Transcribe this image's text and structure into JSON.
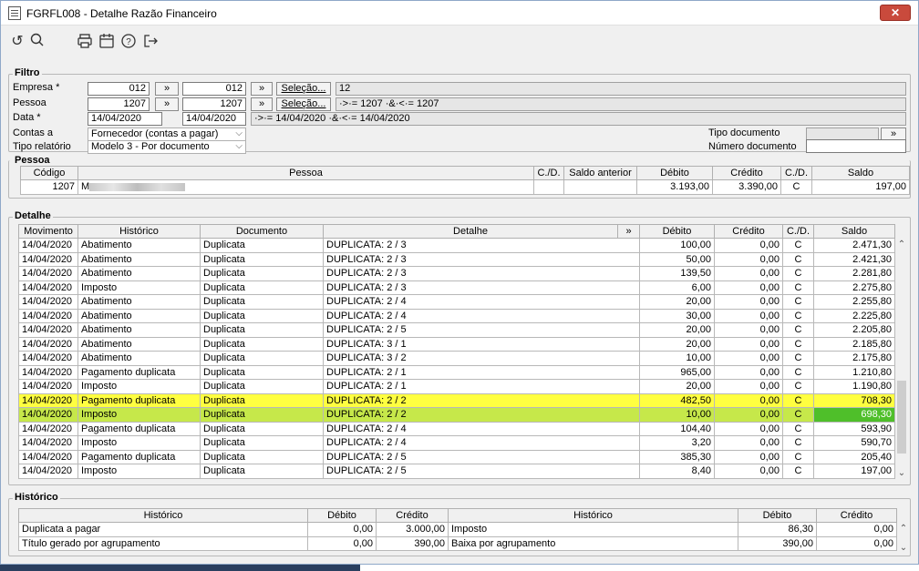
{
  "window": {
    "title": "FGRFL008 - Detalhe Razão Financeiro",
    "close": "✕"
  },
  "toolbar": {
    "undo_icon": "↺",
    "search_icon": "🔍",
    "print_icon": "⎙",
    "calendar_icon": "▦",
    "help_icon": "?",
    "exit_icon": "↦"
  },
  "filtro": {
    "legend": "Filtro",
    "empresa_label": "Empresa *",
    "empresa_from": "012",
    "empresa_to": "012",
    "pessoa_label": "Pessoa",
    "pessoa_from": "1207",
    "pessoa_to": "1207",
    "data_label": "Data *",
    "data_from": "14/04/2020",
    "data_to": "14/04/2020",
    "range_btn": "»",
    "selecao_label": "Seleção...",
    "empresa_sel": "12",
    "pessoa_sel": "·>·= 1207 ·&·<·= 1207",
    "data_sel": "·>·= 14/04/2020 ·&·<·= 14/04/2020",
    "contas_label": "Contas a",
    "contas_value": "Fornecedor (contas a pagar)",
    "tipo_rel_label": "Tipo relatório",
    "tipo_rel_value": "Modelo 3 - Por documento",
    "tipo_doc_label": "Tipo documento",
    "tipo_doc_btn": "»",
    "num_doc_label": "Número documento",
    "dropdown_icon": "⌵"
  },
  "pessoa": {
    "legend": "Pessoa",
    "columns": [
      "Código",
      "Pessoa",
      "C./D.",
      "Saldo anterior",
      "Débito",
      "Crédito",
      "C./D.",
      "Saldo"
    ],
    "row": {
      "codigo": "1207",
      "nome_prefix": "M",
      "cd1": "",
      "saldo_anterior": "",
      "debito": "3.193,00",
      "credito": "3.390,00",
      "cd2": "C",
      "saldo": "197,00"
    }
  },
  "detalhe": {
    "legend": "Detalhe",
    "columns": [
      "Movimento",
      "Histórico",
      "Documento",
      "Detalhe",
      "»",
      "Débito",
      "Crédito",
      "C./D.",
      "Saldo"
    ],
    "rows": [
      [
        "14/04/2020",
        "Abatimento",
        "Duplicata",
        "DUPLICATA: 2 / 3",
        "100,00",
        "0,00",
        "C",
        "2.471,30"
      ],
      [
        "14/04/2020",
        "Abatimento",
        "Duplicata",
        "DUPLICATA: 2 / 3",
        "50,00",
        "0,00",
        "C",
        "2.421,30"
      ],
      [
        "14/04/2020",
        "Abatimento",
        "Duplicata",
        "DUPLICATA: 2 / 3",
        "139,50",
        "0,00",
        "C",
        "2.281,80"
      ],
      [
        "14/04/2020",
        "Imposto",
        "Duplicata",
        "DUPLICATA: 2 / 3",
        "6,00",
        "0,00",
        "C",
        "2.275,80"
      ],
      [
        "14/04/2020",
        "Abatimento",
        "Duplicata",
        "DUPLICATA: 2 / 4",
        "20,00",
        "0,00",
        "C",
        "2.255,80"
      ],
      [
        "14/04/2020",
        "Abatimento",
        "Duplicata",
        "DUPLICATA: 2 / 4",
        "30,00",
        "0,00",
        "C",
        "2.225,80"
      ],
      [
        "14/04/2020",
        "Abatimento",
        "Duplicata",
        "DUPLICATA: 2 / 5",
        "20,00",
        "0,00",
        "C",
        "2.205,80"
      ],
      [
        "14/04/2020",
        "Abatimento",
        "Duplicata",
        "DUPLICATA: 3 / 1",
        "20,00",
        "0,00",
        "C",
        "2.185,80"
      ],
      [
        "14/04/2020",
        "Abatimento",
        "Duplicata",
        "DUPLICATA: 3 / 2",
        "10,00",
        "0,00",
        "C",
        "2.175,80"
      ],
      [
        "14/04/2020",
        "Pagamento duplicata",
        "Duplicata",
        "DUPLICATA: 2 / 1",
        "965,00",
        "0,00",
        "C",
        "1.210,80"
      ],
      [
        "14/04/2020",
        "Imposto",
        "Duplicata",
        "DUPLICATA: 2 / 1",
        "20,00",
        "0,00",
        "C",
        "1.190,80"
      ],
      [
        "14/04/2020",
        "Pagamento duplicata",
        "Duplicata",
        "DUPLICATA: 2 / 2",
        "482,50",
        "0,00",
        "C",
        "708,30"
      ],
      [
        "14/04/2020",
        "Imposto",
        "Duplicata",
        "DUPLICATA: 2 / 2",
        "10,00",
        "0,00",
        "C",
        "698,30"
      ],
      [
        "14/04/2020",
        "Pagamento duplicata",
        "Duplicata",
        "DUPLICATA: 2 / 4",
        "104,40",
        "0,00",
        "C",
        "593,90"
      ],
      [
        "14/04/2020",
        "Imposto",
        "Duplicata",
        "DUPLICATA: 2 / 4",
        "3,20",
        "0,00",
        "C",
        "590,70"
      ],
      [
        "14/04/2020",
        "Pagamento duplicata",
        "Duplicata",
        "DUPLICATA: 2 / 5",
        "385,30",
        "0,00",
        "C",
        "205,40"
      ],
      [
        "14/04/2020",
        "Imposto",
        "Duplicata",
        "DUPLICATA: 2 / 5",
        "8,40",
        "0,00",
        "C",
        "197,00"
      ]
    ],
    "highlight_yellow_row": 11,
    "highlight_green_row": 12
  },
  "historico": {
    "legend": "Histórico",
    "columns": [
      "Histórico",
      "Débito",
      "Crédito",
      "Histórico",
      "Débito",
      "Crédito"
    ],
    "rows": [
      [
        "Duplicata a pagar",
        "0,00",
        "3.000,00",
        "Imposto",
        "86,30",
        "0,00"
      ],
      [
        "Título gerado por agrupamento",
        "0,00",
        "390,00",
        "Baixa por agrupamento",
        "390,00",
        "0,00"
      ]
    ]
  },
  "scroll": {
    "up": "⌃",
    "down": "⌄"
  }
}
